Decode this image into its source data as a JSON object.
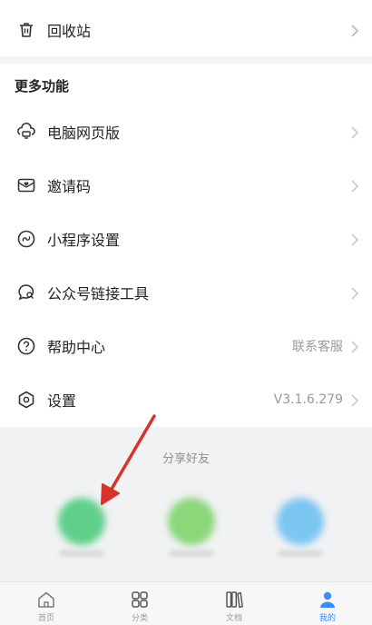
{
  "top_item": {
    "label": "回收站",
    "icon": "trash-icon"
  },
  "section": {
    "title": "更多功能"
  },
  "menu": [
    {
      "label": "电脑网页版",
      "value": "",
      "icon": "cloud-monitor-icon"
    },
    {
      "label": "邀请码",
      "value": "",
      "icon": "mail-heart-icon"
    },
    {
      "label": "小程序设置",
      "value": "",
      "icon": "miniprogram-icon"
    },
    {
      "label": "公众号链接工具",
      "value": "",
      "icon": "chat-search-icon"
    },
    {
      "label": "帮助中心",
      "value": "联系客服",
      "icon": "help-icon"
    },
    {
      "label": "设置",
      "value": "V3.1.6.279",
      "icon": "settings-hexagon-icon"
    }
  ],
  "share": {
    "title": "分享好友"
  },
  "tabs": [
    {
      "label": "首页",
      "icon": "home-icon",
      "active": false
    },
    {
      "label": "分类",
      "icon": "grid-icon",
      "active": false
    },
    {
      "label": "文档",
      "icon": "documents-icon",
      "active": false
    },
    {
      "label": "我的",
      "icon": "user-icon",
      "active": true
    }
  ],
  "colors": {
    "accent": "#3b8cff",
    "arrow": "#d9322b"
  }
}
